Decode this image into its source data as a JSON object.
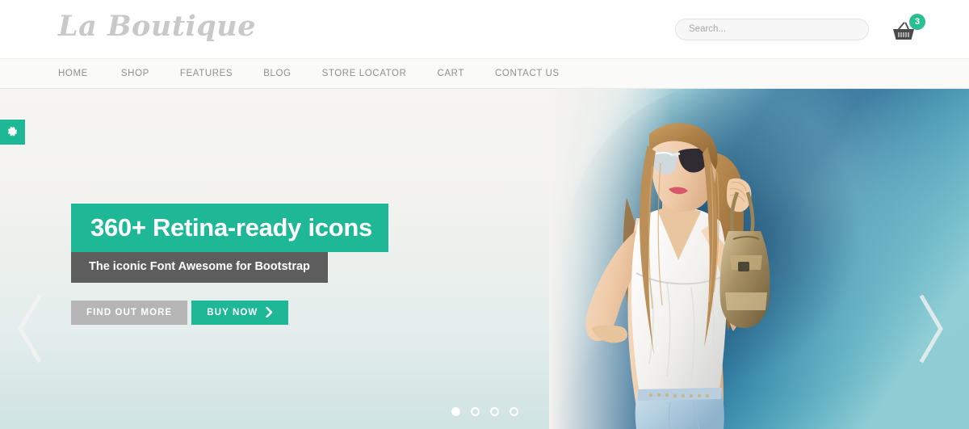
{
  "header": {
    "logo_text": "La Boutique",
    "search": {
      "placeholder": "Search...",
      "value": ""
    },
    "cart": {
      "icon": "shopping-basket-icon",
      "badge_count": "3"
    }
  },
  "nav": {
    "items": [
      {
        "label": "HOME"
      },
      {
        "label": "SHOP"
      },
      {
        "label": "FEATURES"
      },
      {
        "label": "BLOG"
      },
      {
        "label": "STORE LOCATOR"
      },
      {
        "label": "CART"
      },
      {
        "label": "CONTACT US"
      }
    ]
  },
  "hero": {
    "settings_icon": "gear-icon",
    "caption": {
      "title": "360+ Retina-ready icons",
      "subtitle": "The iconic Font Awesome for Bootstrap",
      "buttons": [
        {
          "label": "FIND OUT MORE",
          "style": "secondary",
          "arrow": false
        },
        {
          "label": "BUY NOW",
          "style": "primary",
          "arrow": true
        }
      ]
    },
    "prev_icon": "chevron-left-icon",
    "next_icon": "chevron-right-icon",
    "slides": [
      {
        "active": true
      },
      {
        "active": false
      },
      {
        "active": false
      },
      {
        "active": false
      }
    ],
    "image_alt": "fashion model in sunglasses white tank top and jeans holding a handbag against a teal wall"
  },
  "colors": {
    "accent_green": "#1fb896",
    "badge_green": "#2bbd94",
    "subtitle_gray": "#5d5d5d",
    "button_gray": "#b5b5b5",
    "logo_gray": "#c9c9c9",
    "nav_text": "#8f8f8f",
    "navbar_bg": "#fafaf9"
  }
}
